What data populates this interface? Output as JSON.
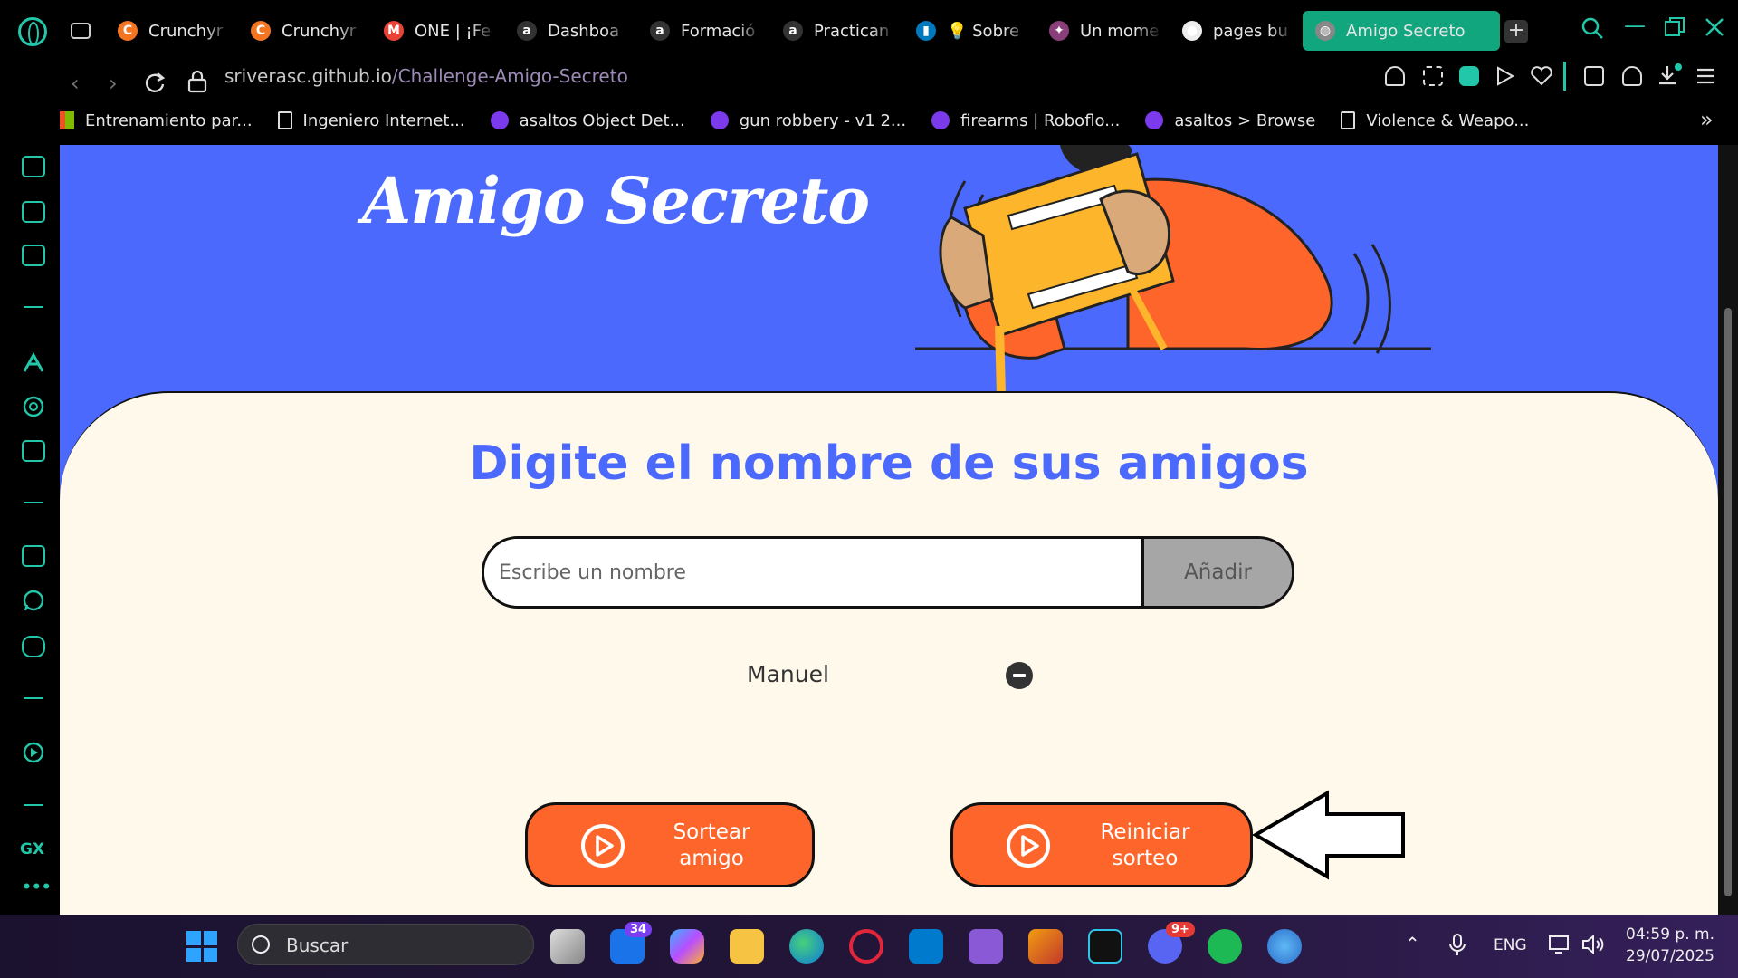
{
  "browser": {
    "tabs": [
      {
        "label": "Crunchyr",
        "color": "#f47521",
        "glyph": "C"
      },
      {
        "label": "Crunchyr",
        "color": "#f47521",
        "glyph": "C"
      },
      {
        "label": "ONE | ¡Fe",
        "color": "#ea4335",
        "glyph": "M"
      },
      {
        "label": "Dashboa",
        "color": "#333333",
        "glyph": "a"
      },
      {
        "label": "Formació",
        "color": "#333333",
        "glyph": "a"
      },
      {
        "label": "Practican",
        "color": "#333333",
        "glyph": "a"
      },
      {
        "label": "💡 Sobre",
        "color": "#0079bf",
        "glyph": "▮"
      },
      {
        "label": "Un mome",
        "color": "#8a3f7a",
        "glyph": "✦"
      },
      {
        "label": "pages bu",
        "color": "#eeeeee",
        "glyph": "●"
      },
      {
        "label": "Amigo Secreto",
        "color": "#888888",
        "glyph": "◍"
      }
    ],
    "new_tab_label": "+",
    "url_domain": "sriverasc.github.io",
    "url_path": "/Challenge-Amigo-Secreto",
    "bookmarks": [
      {
        "label": "Entrenamiento par...",
        "type": "ms"
      },
      {
        "label": "Ingeniero Internet...",
        "type": "doc"
      },
      {
        "label": "asaltos Object Det...",
        "type": "rf"
      },
      {
        "label": "gun robbery - v1 2...",
        "type": "rf"
      },
      {
        "label": "firearms | Roboflo...",
        "type": "rf"
      },
      {
        "label": "asaltos > Browse",
        "type": "rf"
      },
      {
        "label": "Violence & Weapo...",
        "type": "doc"
      }
    ],
    "sidebar_gx_label": "GX",
    "sidebar_more_label": "•••",
    "accent": "#22c7a9"
  },
  "page": {
    "title": "Amigo Secreto",
    "heading": "Digite el nombre de sus amigos",
    "input_placeholder": "Escribe un nombre",
    "add_label": "Añadir",
    "friends": [
      "Manuel"
    ],
    "draw_label_line1": "Sortear",
    "draw_label_line2": "amigo",
    "reset_label_line1": "Reiniciar",
    "reset_label_line2": "sorteo",
    "colors": {
      "banner": "#4b69fd",
      "card": "#fff9eb",
      "button": "#fe652b",
      "add_button": "#a6a6a6"
    }
  },
  "taskbar": {
    "search_label": "Buscar",
    "mail_badge": "34",
    "discord_badge": "9+",
    "language": "ENG",
    "time": "04:59 p. m.",
    "date": "29/07/2025"
  }
}
